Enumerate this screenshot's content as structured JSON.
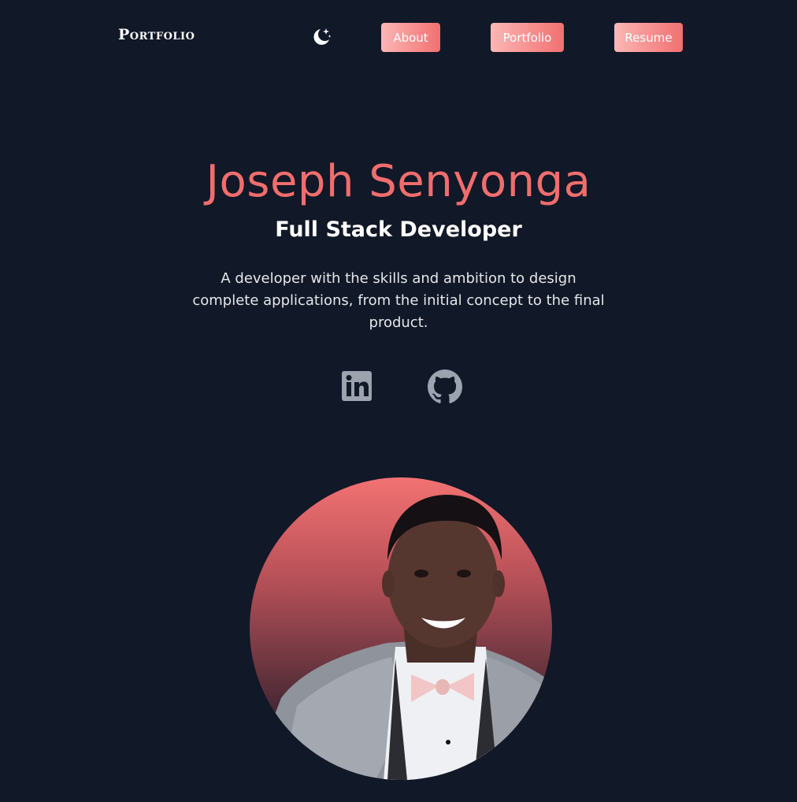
{
  "nav": {
    "logo": "Portfolio",
    "theme_icon": "moon-stars-icon",
    "buttons": [
      {
        "label": "About"
      },
      {
        "label": "Portfolio"
      },
      {
        "label": "Resume"
      }
    ]
  },
  "hero": {
    "name": "Joseph Senyonga",
    "role": "Full Stack Developer",
    "description": "A developer with the skills and ambition to design complete applications, from the initial concept to the final product."
  },
  "social": [
    {
      "icon": "linkedin-icon"
    },
    {
      "icon": "github-icon"
    }
  ],
  "colors": {
    "background": "#111827",
    "accent": "#f16d6d",
    "button_gradient_start": "#fcb6b6",
    "button_gradient_end": "#f17070",
    "icon_gray": "#9ca3af"
  }
}
